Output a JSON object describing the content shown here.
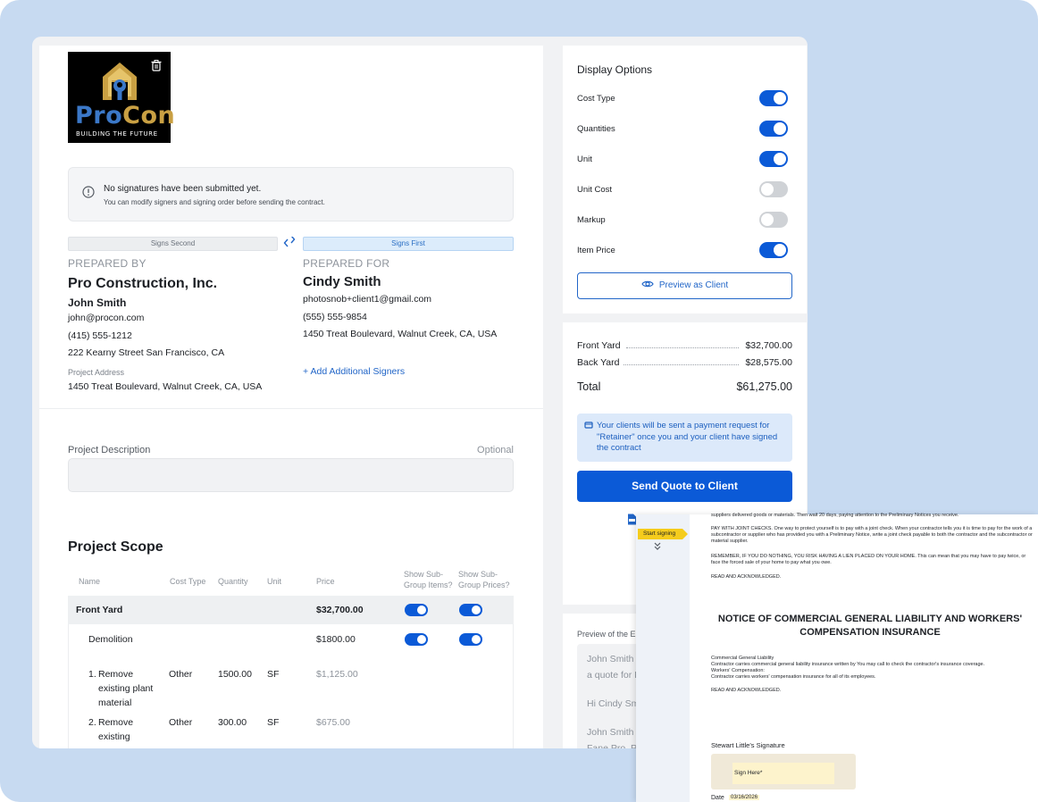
{
  "logo": {
    "brand_pro": "Pro",
    "brand_con": "Con",
    "tagline": "BUILDING THE FUTURE"
  },
  "alert": {
    "title": "No signatures have been submitted yet.",
    "subtitle": "You can modify signers and signing order before sending the contract."
  },
  "signers": {
    "left_order": "Signs Second",
    "right_order": "Signs First",
    "prepared_by_label": "PREPARED BY",
    "prepared_for_label": "PREPARED FOR",
    "company": "Pro Construction, Inc.",
    "contractor_name": "John Smith",
    "contractor_email": "john@procon.com",
    "contractor_phone": "(415) 555-1212",
    "contractor_address": "222 Kearny Street San Francisco, CA",
    "project_address_label": "Project Address",
    "project_address": "1450 Treat Boulevard, Walnut Creek, CA, USA",
    "client_name": "Cindy Smith",
    "client_email": "photosnob+client1@gmail.com",
    "client_phone": "(555) 555-9854",
    "client_address": "1450 Treat Boulevard, Walnut Creek, CA, USA",
    "add_signers": "+ Add Additional Signers"
  },
  "project_description": {
    "label": "Project Description",
    "optional": "Optional",
    "value": ""
  },
  "scope": {
    "title": "Project Scope",
    "headers": {
      "name": "Name",
      "cost_type": "Cost Type",
      "quantity": "Quantity",
      "unit": "Unit",
      "price": "Price",
      "show_items_1": "Show Sub-",
      "show_items_2": "Group Items?",
      "show_prices_1": "Show Sub-",
      "show_prices_2": "Group Prices?"
    },
    "group": {
      "name": "Front Yard",
      "price": "$32,700.00",
      "show_items": true,
      "show_prices": true
    },
    "subgroup": {
      "name": "Demolition",
      "price": "$1800.00",
      "show_items": true,
      "show_prices": true
    },
    "items": [
      {
        "num": "1.",
        "name_l1": "Remove",
        "name_l2": "existing plant",
        "name_l3": "material",
        "cost_type": "Other",
        "quantity": "1500.00",
        "unit": "SF",
        "price": "$1,125.00"
      },
      {
        "num": "2.",
        "name_l1": "Remove",
        "name_l2": "existing",
        "name_l3": "",
        "cost_type": "Other",
        "quantity": "300.00",
        "unit": "SF",
        "price": "$675.00"
      }
    ]
  },
  "display_options": {
    "title": "Display Options",
    "options": [
      {
        "label": "Cost Type",
        "on": true
      },
      {
        "label": "Quantities",
        "on": true
      },
      {
        "label": "Unit",
        "on": true
      },
      {
        "label": "Unit Cost",
        "on": false
      },
      {
        "label": "Markup",
        "on": false
      },
      {
        "label": "Item Price",
        "on": true
      }
    ],
    "preview_button": "Preview as Client"
  },
  "summary": {
    "rows": [
      {
        "label": "Front Yard",
        "value": "$32,700.00"
      },
      {
        "label": "Back Yard",
        "value": "$28,575.00"
      }
    ],
    "total_label": "Total",
    "total_value": "$61,275.00",
    "notice": "Your clients will be sent a payment request for \"Retainer\" once you and your client have signed the contract",
    "send_button": "Send Quote to Client"
  },
  "email_preview": {
    "title": "Preview of the E",
    "lines": [
      "John Smith",
      "a quote for I",
      "Hi Cindy Sm",
      "John Smith",
      "Fane Pro, Pl"
    ]
  },
  "document": {
    "start_signing": "Start signing",
    "p0": "suppliers delivered goods or materials. Then wait 20 days, paying attention to the Preliminary Notices you receive.",
    "p1": "PAY WITH JOINT CHECKS. One way to protect yourself is to pay with a joint check. When your contractor tells you it is time to pay for the work of a subcontractor or supplier who has provided you with a Preliminary Notice, write a joint check payable to both the contractor and the subcontractor or material supplier.",
    "p2": "REMEMBER, IF YOU DO NOTHING, YOU RISK HAVING A LIEN PLACED ON YOUR HOME. This can mean that you may have to pay twice, or face the forced sale of your home to pay what you owe.",
    "ack1": "READ AND ACKNOWLEDGED.",
    "heading": "NOTICE OF COMMERCIAL GENERAL LIABILITY AND WORKERS' COMPENSATION INSURANCE",
    "cgl_title": "Commercial General Liability",
    "cgl_text": "Contractor carries commercial general liability insurance written by   You may call   to check the contractor's insurance coverage.",
    "wc_title": "Workers' Compensation:",
    "wc_text": "Contractor carries workers' compensation insurance for all of its employees.",
    "ack2": "READ AND ACKNOWLEDGED.",
    "signature_label": "Stewart Little's Signature",
    "sign_here": "Sign Here*",
    "date_label": "Date",
    "date_value": "03/16/2026"
  },
  "colors": {
    "accent": "#0b5ad7",
    "background": "#c7daf1",
    "brand_blue": "#3b78c8",
    "brand_gold": "#c9a043",
    "sign_tag": "#f5cc1c"
  }
}
